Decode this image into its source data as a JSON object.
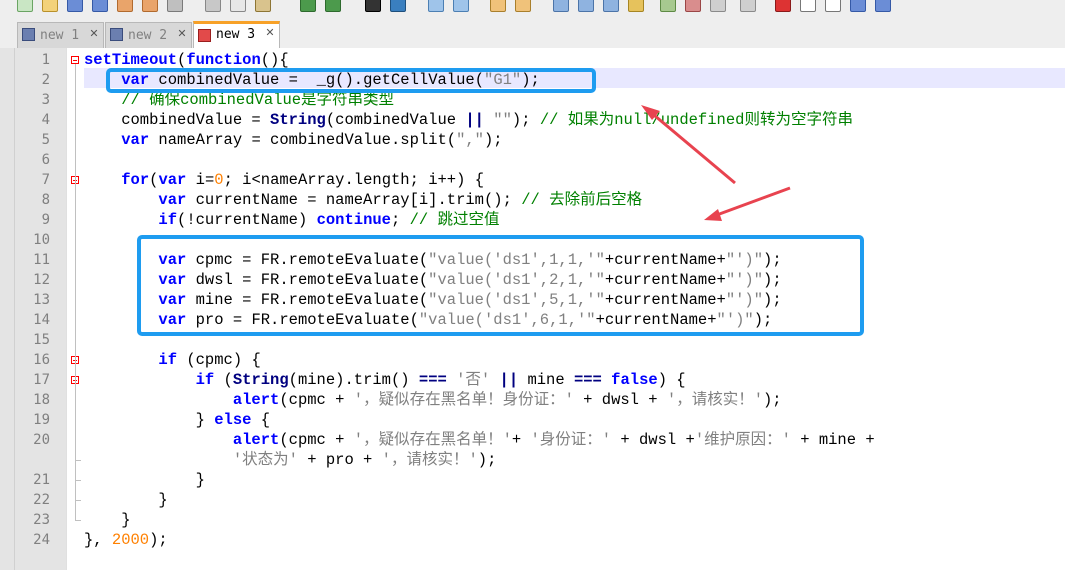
{
  "tabs": [
    {
      "label": "new 1",
      "icon": "file-modified-icon",
      "active": false
    },
    {
      "label": "new 2",
      "icon": "file-modified-icon",
      "active": false
    },
    {
      "label": "new 3",
      "icon": "file-unsaved-icon",
      "active": true
    }
  ],
  "editor": {
    "line_numbers": [
      "1",
      "2",
      "3",
      "4",
      "5",
      "6",
      "7",
      "8",
      "9",
      "10",
      "11",
      "12",
      "13",
      "14",
      "15",
      "16",
      "17",
      "18",
      "19",
      "20",
      "21",
      "22",
      "23",
      "24"
    ],
    "lines": [
      [
        [
          "k",
          "setTimeout"
        ],
        [
          "t",
          "("
        ],
        [
          "k",
          "function"
        ],
        [
          "t",
          "(){"
        ]
      ],
      [
        [
          "t",
          "    "
        ],
        [
          "k",
          "var"
        ],
        [
          "t",
          " combinedValue =  "
        ],
        [
          "t",
          "_g"
        ],
        [
          "t",
          "()"
        ],
        [
          "t",
          ".getCellValue("
        ],
        [
          "s",
          "\"G1\""
        ],
        [
          "t",
          ");"
        ]
      ],
      [
        [
          "t",
          "    "
        ],
        [
          "c",
          "// 确保combinedValue是字符串类型"
        ]
      ],
      [
        [
          "t",
          "    combinedValue = "
        ],
        [
          "b",
          "String"
        ],
        [
          "t",
          "(combinedValue "
        ],
        [
          "o",
          "||"
        ],
        [
          "t",
          " "
        ],
        [
          "s",
          "\"\""
        ],
        [
          "t",
          "); "
        ],
        [
          "c",
          "// 如果为null/undefined则转为空字符串"
        ]
      ],
      [
        [
          "t",
          "    "
        ],
        [
          "k",
          "var"
        ],
        [
          "t",
          " nameArray = combinedValue.split("
        ],
        [
          "s",
          "\",\""
        ],
        [
          "t",
          ");"
        ]
      ],
      [],
      [
        [
          "t",
          "    "
        ],
        [
          "k",
          "for"
        ],
        [
          "t",
          "("
        ],
        [
          "k",
          "var"
        ],
        [
          "t",
          " i="
        ],
        [
          "n",
          "0"
        ],
        [
          "t",
          "; i<nameArray.length; i++) {"
        ]
      ],
      [
        [
          "t",
          "        "
        ],
        [
          "k",
          "var"
        ],
        [
          "t",
          " currentName = nameArray[i].trim(); "
        ],
        [
          "c",
          "// 去除前后空格"
        ]
      ],
      [
        [
          "t",
          "        "
        ],
        [
          "k",
          "if"
        ],
        [
          "t",
          "(!currentName) "
        ],
        [
          "k",
          "continue"
        ],
        [
          "t",
          "; "
        ],
        [
          "c",
          "// 跳过空值"
        ]
      ],
      [],
      [
        [
          "t",
          "        "
        ],
        [
          "k",
          "var"
        ],
        [
          "t",
          " cpmc = FR.remoteEvaluate("
        ],
        [
          "s",
          "\"value('ds1',1,1,'\""
        ],
        [
          "t",
          "+currentName+"
        ],
        [
          "s",
          "\"')\""
        ],
        [
          "t",
          ");"
        ]
      ],
      [
        [
          "t",
          "        "
        ],
        [
          "k",
          "var"
        ],
        [
          "t",
          " dwsl = FR.remoteEvaluate("
        ],
        [
          "s",
          "\"value('ds1',2,1,'\""
        ],
        [
          "t",
          "+currentName+"
        ],
        [
          "s",
          "\"')\""
        ],
        [
          "t",
          ");"
        ]
      ],
      [
        [
          "t",
          "        "
        ],
        [
          "k",
          "var"
        ],
        [
          "t",
          " mine = FR.remoteEvaluate("
        ],
        [
          "s",
          "\"value('ds1',5,1,'\""
        ],
        [
          "t",
          "+currentName+"
        ],
        [
          "s",
          "\"')\""
        ],
        [
          "t",
          ");"
        ]
      ],
      [
        [
          "t",
          "        "
        ],
        [
          "k",
          "var"
        ],
        [
          "t",
          " pro = FR.remoteEvaluate("
        ],
        [
          "s",
          "\"value('ds1',6,1,'\""
        ],
        [
          "t",
          "+currentName+"
        ],
        [
          "s",
          "\"')\""
        ],
        [
          "t",
          ");"
        ]
      ],
      [],
      [
        [
          "t",
          "        "
        ],
        [
          "k",
          "if"
        ],
        [
          "t",
          " (cpmc) {"
        ]
      ],
      [
        [
          "t",
          "            "
        ],
        [
          "k",
          "if"
        ],
        [
          "t",
          " ("
        ],
        [
          "b",
          "String"
        ],
        [
          "t",
          "(mine).trim() "
        ],
        [
          "o",
          "==="
        ],
        [
          "t",
          " "
        ],
        [
          "s",
          "'否'"
        ],
        [
          "t",
          " "
        ],
        [
          "o",
          "||"
        ],
        [
          "t",
          " mine "
        ],
        [
          "o",
          "==="
        ],
        [
          "t",
          " "
        ],
        [
          "k",
          "false"
        ],
        [
          "t",
          ") {"
        ]
      ],
      [
        [
          "t",
          "                "
        ],
        [
          "k",
          "alert"
        ],
        [
          "t",
          "(cpmc + "
        ],
        [
          "s",
          "'，疑似存在黑名单！身份证：'"
        ],
        [
          "t",
          " + dwsl + "
        ],
        [
          "s",
          "'，请核实！'"
        ],
        [
          "t",
          ");"
        ]
      ],
      [
        [
          "t",
          "            } "
        ],
        [
          "k",
          "else"
        ],
        [
          "t",
          " {"
        ]
      ],
      [
        [
          "t",
          "                "
        ],
        [
          "k",
          "alert"
        ],
        [
          "t",
          "(cpmc + "
        ],
        [
          "s",
          "'，疑似存在黑名单！'"
        ],
        [
          "t",
          "+ "
        ],
        [
          "s",
          "'身份证：'"
        ],
        [
          "t",
          " + dwsl +"
        ],
        [
          "s",
          "'维护原因：'"
        ],
        [
          "t",
          " + mine +"
        ]
      ],
      [
        [
          "t",
          "                "
        ],
        [
          "s",
          "'状态为'"
        ],
        [
          "t",
          " + pro + "
        ],
        [
          "s",
          "'，请核实！'"
        ],
        [
          "t",
          ");"
        ]
      ],
      [
        [
          "t",
          "            }"
        ]
      ],
      [
        [
          "t",
          "        }"
        ]
      ],
      [
        [
          "t",
          "    }"
        ]
      ],
      [
        [
          "t",
          "}, "
        ],
        [
          "n",
          "2000"
        ],
        [
          "t",
          ");"
        ]
      ]
    ]
  },
  "colors": {
    "highlight_box": "#1e9cf0",
    "arrow": "#e8434f",
    "current_line": "#e8e8ff"
  }
}
